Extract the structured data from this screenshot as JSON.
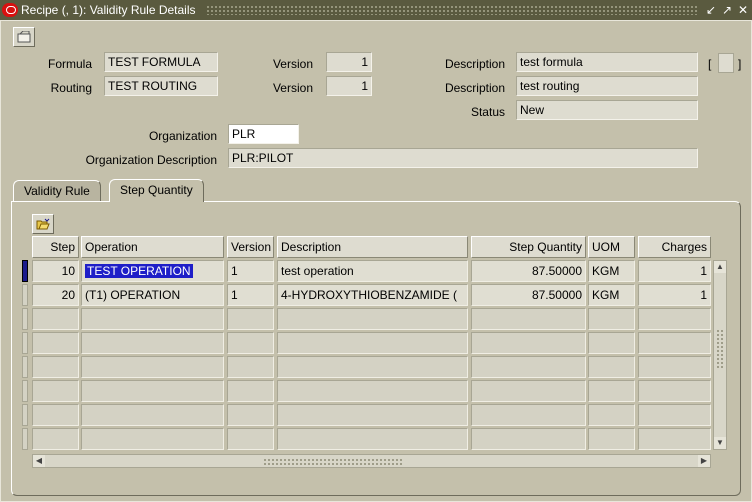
{
  "window": {
    "title": "Recipe (, 1): Validity Rule Details"
  },
  "header": {
    "formula_label": "Formula",
    "formula_value": "TEST FORMULA",
    "routing_label": "Routing",
    "routing_value": "TEST ROUTING",
    "version_label_1": "Version",
    "formula_version": "1",
    "version_label_2": "Version",
    "routing_version": "1",
    "description_label_1": "Description",
    "formula_description": "test formula",
    "description_label_2": "Description",
    "routing_description": "test routing",
    "status_label": "Status",
    "status_value": "New",
    "organization_label": "Organization",
    "organization_value": "PLR",
    "org_description_label": "Organization Description",
    "org_description_value": "PLR:PILOT",
    "bracket_open": "[",
    "bracket_close": "]"
  },
  "tabs": [
    {
      "label": "Validity Rule",
      "active": false
    },
    {
      "label": "Step Quantity",
      "active": true
    }
  ],
  "table": {
    "columns": [
      "Step",
      "Operation",
      "Version",
      "Description",
      "Step Quantity",
      "UOM",
      "Charges"
    ],
    "rows": [
      {
        "step": "10",
        "operation": "TEST OPERATION",
        "version": "1",
        "description": "test operation",
        "qty": "87.50000",
        "uom": "KGM",
        "charges": "1"
      },
      {
        "step": "20",
        "operation": "(T1) OPERATION",
        "version": "1",
        "description": "4-HYDROXYTHIOBENZAMIDE (",
        "qty": "87.50000",
        "uom": "KGM",
        "charges": "1"
      }
    ],
    "empty_rows": 6
  },
  "colors": {
    "selection": "#1e1ec8",
    "titlebar": "#5a5a3f",
    "panel": "#c4c0ab"
  },
  "icons": [
    "oracle-icon",
    "minimize-icon",
    "maximize-icon",
    "close-icon",
    "folder-open-icon",
    "attachment-icon"
  ]
}
